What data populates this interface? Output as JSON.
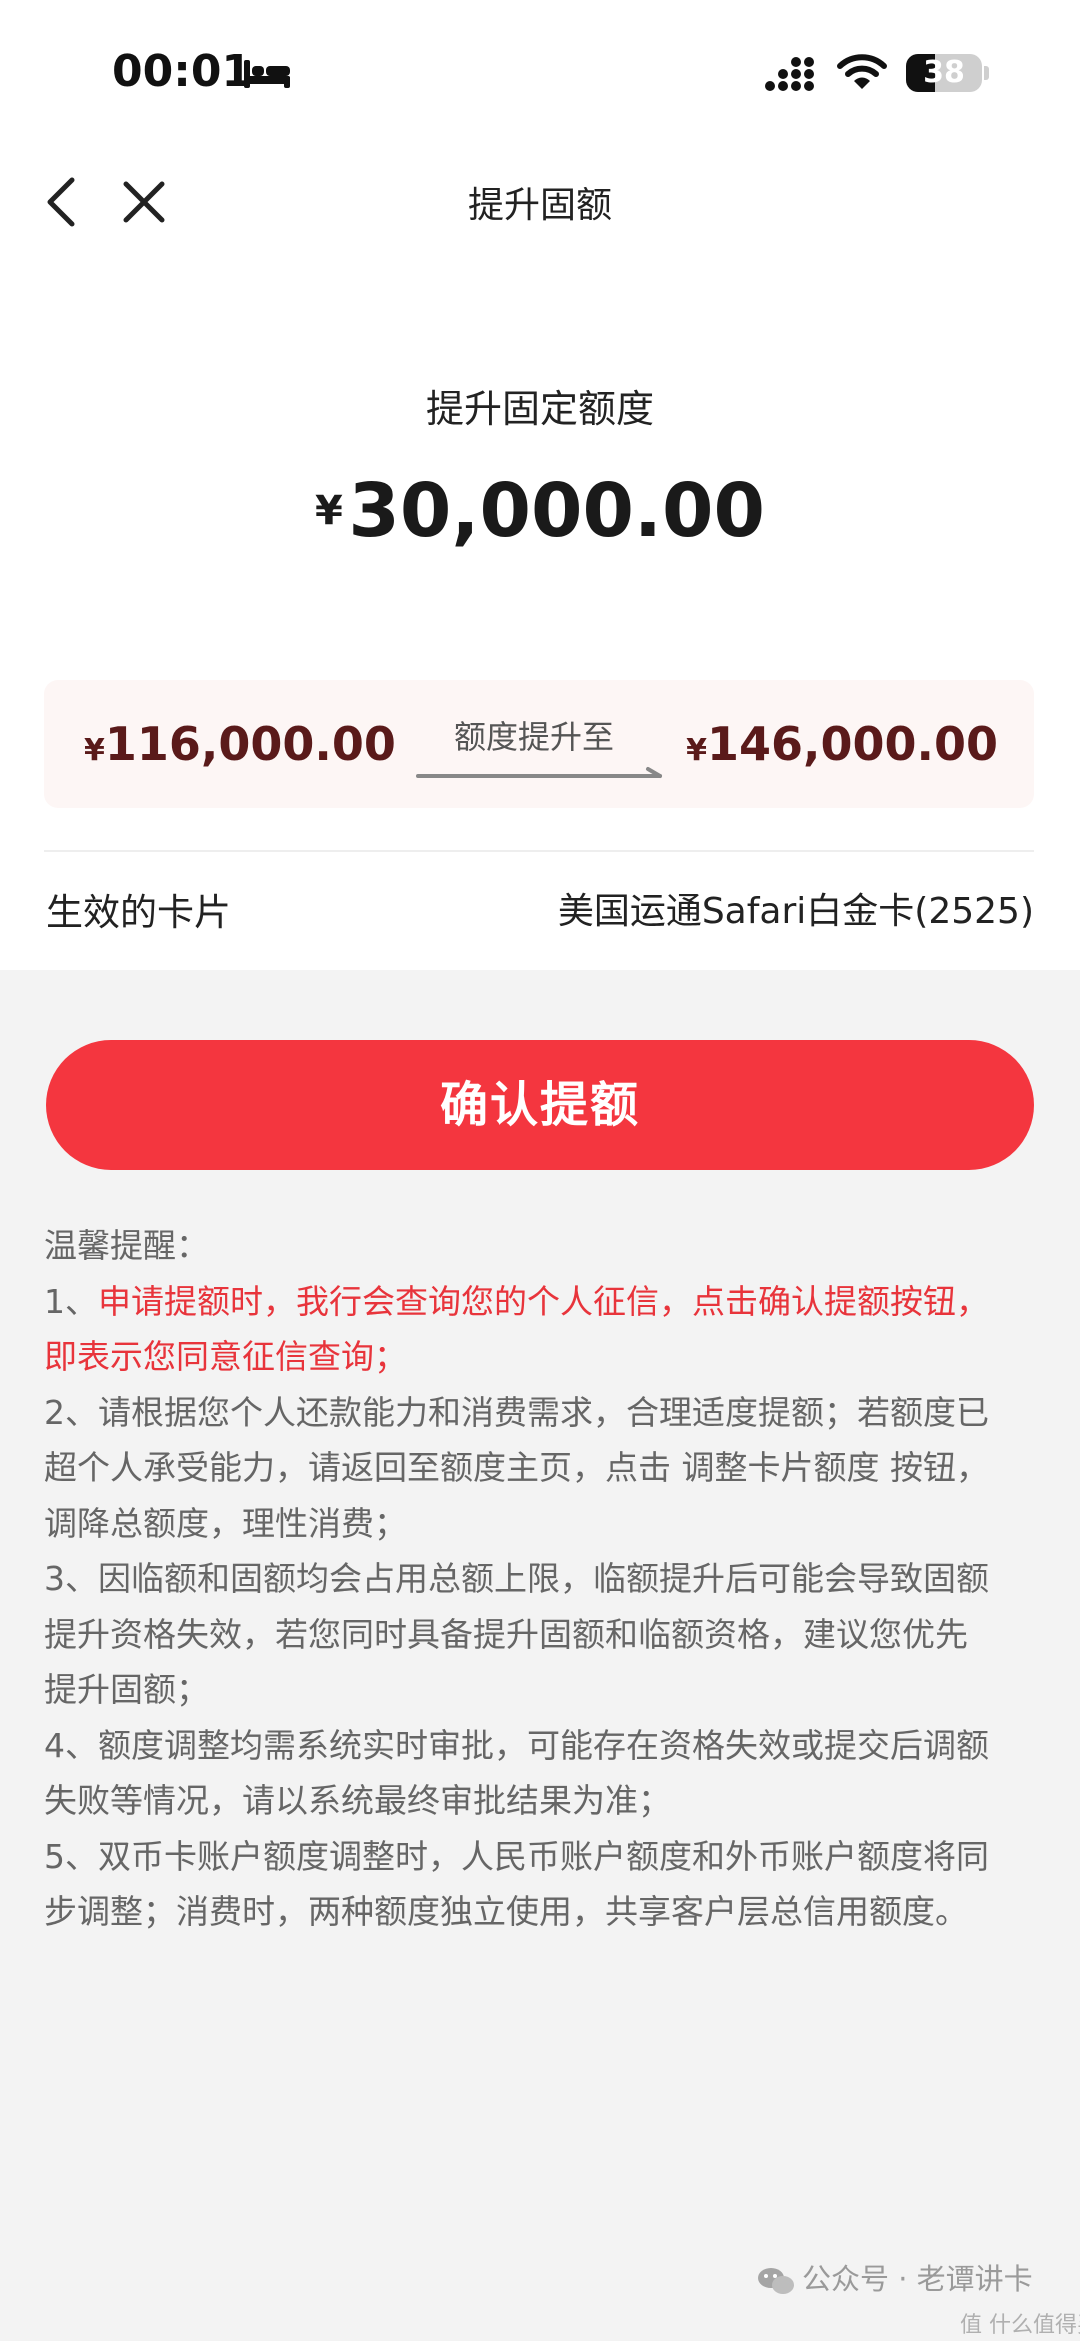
{
  "status_bar": {
    "time": "00:01",
    "battery_level": "38",
    "battery_fraction": 0.38
  },
  "nav": {
    "title": "提升固额",
    "back_icon": "chevron-left-icon",
    "close_icon": "close-icon"
  },
  "header": {
    "subtitle": "提升固定额度",
    "currency": "¥",
    "amount": "30,000.00"
  },
  "limit": {
    "from_currency": "¥",
    "from_value": "116,000.00",
    "label": "额度提升至",
    "to_currency": "¥",
    "to_value": "146,000.00"
  },
  "effective_card": {
    "label": "生效的卡片",
    "value": "美国运通Safari白金卡(2525)"
  },
  "confirm_button": "确认提额",
  "notes": {
    "heading": "温馨提醒：",
    "item1_prefix": "1、",
    "item1_line1": "申请提额时，我行会查询您的个人征信，点击确认提额按钮，",
    "item1_line2": "即表示您同意征信查询；",
    "item2_line1": "2、请根据您个人还款能力和消费需求，合理适度提额；若额度已",
    "item2_line2": "超个人承受能力，请返回至额度主页，点击 调整卡片额度 按钮，",
    "item2_line3": "调降总额度，理性消费；",
    "item3_line1": "3、因临额和固额均会占用总额上限，临额提升后可能会导致固额",
    "item3_line2": "提升资格失效，若您同时具备提升固额和临额资格，建议您优先",
    "item3_line3": "提升固额；",
    "item4_line1": "4、额度调整均需系统实时审批，可能存在资格失效或提交后调额",
    "item4_line2": "失败等情况，请以系统最终审批结果为准；",
    "item5_line1": "5、双币卡账户额度调整时，人民币账户额度和外币账户额度将同",
    "item5_line2": "步调整；消费时，两种额度独立使用，共享客户层总信用额度。"
  },
  "watermark": {
    "text": "公众号 · 老谭讲卡",
    "sub": "值 什么值得买"
  },
  "colors": {
    "accent": "#f4363f",
    "warning_text": "#e8343b",
    "amount_dark": "#5a1a1a",
    "card_bg": "#fdf6f5",
    "page_bg": "#f3f3f3"
  }
}
